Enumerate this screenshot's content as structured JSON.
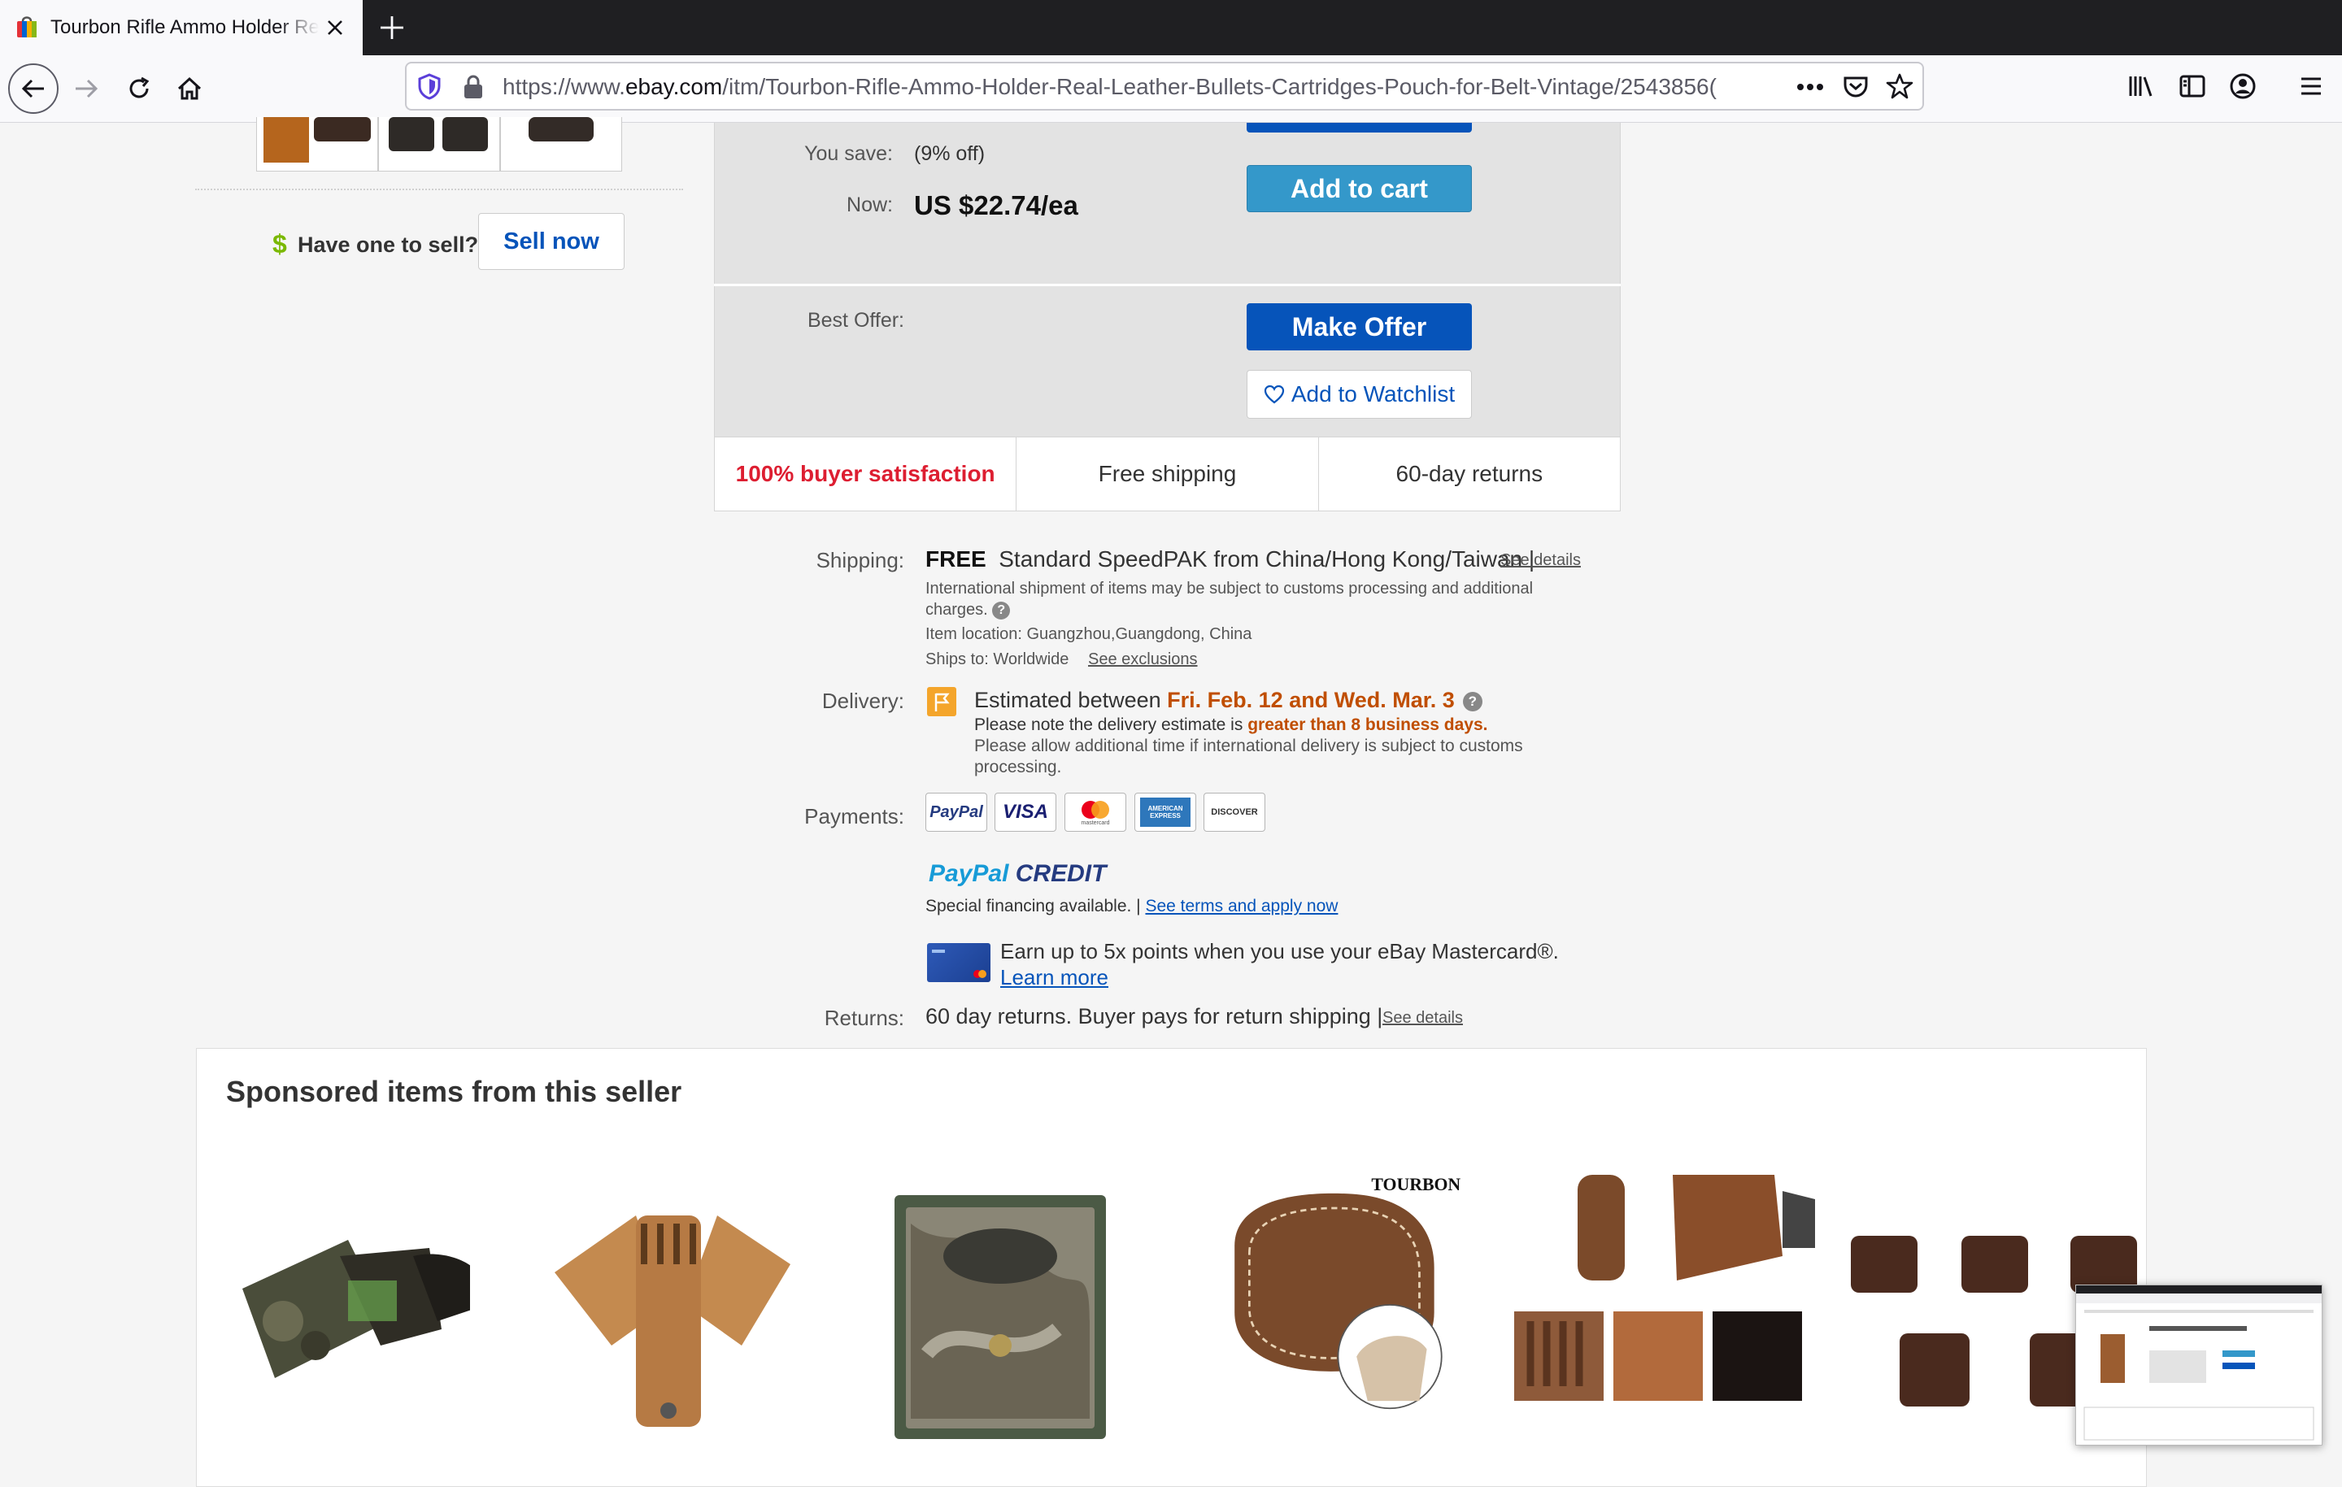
{
  "browser": {
    "tab_title": "Tourbon Rifle Ammo Holder Real Leather Bullets Cartridges Pouch for Belt Vintage",
    "url_prefix": "https://www.",
    "url_domain": "ebay.com",
    "url_path": "/itm/Tourbon-Rifle-Ammo-Holder-Real-Leather-Bullets-Cartridges-Pouch-for-Belt-Vintage/2543856("
  },
  "sell": {
    "dollar": "$",
    "prompt": "Have one to sell?",
    "button": "Sell now"
  },
  "buybox": {
    "you_save_label": "You save:",
    "you_save_value": "(9% off)",
    "now_label": "Now:",
    "now_value": "US $22.74/ea",
    "add_to_cart": "Add to cart",
    "best_offer_label": "Best Offer:",
    "make_offer": "Make Offer",
    "watchlist": "Add to Watchlist",
    "badges": [
      "100% buyer satisfaction",
      "Free shipping",
      "60-day returns"
    ]
  },
  "shipping": {
    "label": "Shipping:",
    "free": "FREE",
    "method": "Standard SpeedPAK from China/Hong Kong/Taiwan |",
    "details": "See details",
    "note": "International shipment of items may be subject to customs processing and additional charges.",
    "location": "Item location:  Guangzhou,Guangdong, China",
    "ships_to": "Ships to:  Worldwide",
    "exclusions": "See exclusions"
  },
  "delivery": {
    "label": "Delivery:",
    "est_prefix": "Estimated between",
    "est_dates": "Fri. Feb. 12 and Wed. Mar. 3",
    "note_prefix": "Please note the delivery estimate is",
    "note_bold": "greater than 8 business days.",
    "note2": "Please allow additional time if international delivery is subject to customs processing."
  },
  "payments": {
    "label": "Payments:",
    "cards": [
      "PayPal",
      "VISA",
      "mastercard",
      "AMERICAN EXPRESS",
      "DISCOVER"
    ],
    "paypal": "PayPal",
    "credit": "CREDIT",
    "financing": "Special financing available.  |",
    "terms_link": "See terms and apply now",
    "earn": "Earn up to 5x points when you use your eBay Mastercard®.",
    "learn_more": "Learn more"
  },
  "returns": {
    "label": "Returns:",
    "text": "60 day returns. Buyer pays for return shipping |",
    "details": "See details"
  },
  "sponsored": {
    "title": "Sponsored items from this seller",
    "brand_logo": "TOURBON"
  },
  "colors": {
    "ebay_blue": "#0654ba",
    "cart_blue": "#3498ca",
    "satisfaction_red": "#dd1e31",
    "delivery_orange": "#c04e00"
  }
}
